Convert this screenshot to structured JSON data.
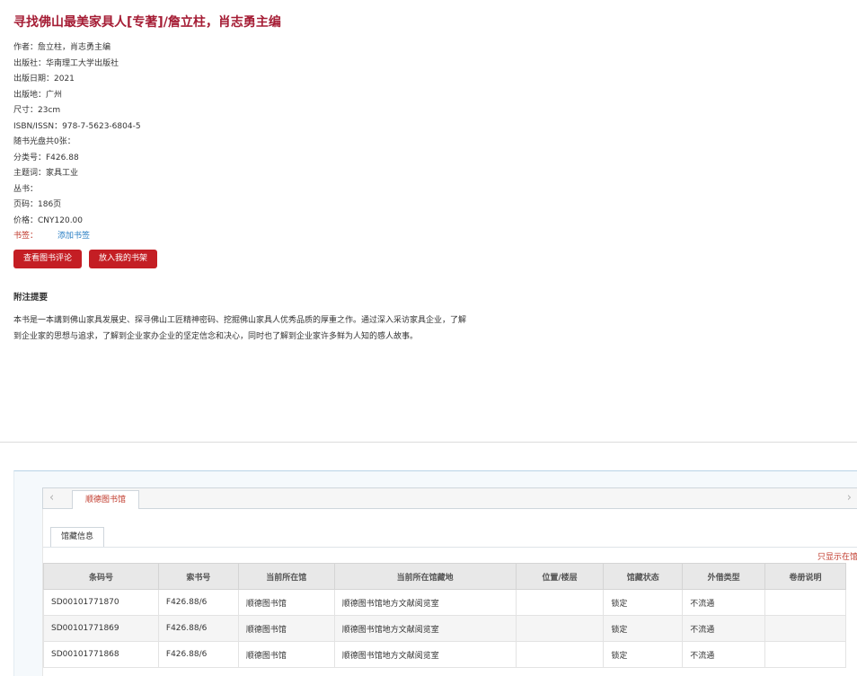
{
  "book": {
    "title": "寻找佛山最美家具人[专著]/詹立柱，肖志勇主编",
    "meta": [
      "作者：詹立柱，肖志勇主编",
      "出版社：华南理工大学出版社",
      "出版日期：2021",
      "出版地：广州",
      "尺寸：23cm",
      "ISBN/ISSN：978-7-5623-6804-5",
      "随书光盘共0张：",
      "分类号：F426.88",
      "主题词：家具工业",
      "丛书：",
      "页码：186页",
      "价格：CNY120.00"
    ],
    "bookmark_label": "书签：",
    "bookmark_link": "添加书签"
  },
  "actions": {
    "review_button": "查看图书评论",
    "shelf_button": "放入我的书架"
  },
  "notes": {
    "title": "附注提要",
    "body": "本书是一本講到佛山家具发展史、探寻佛山工匠精神密码、挖掘佛山家具人优秀品质的厚重之作。通过深入采访家具企业，了解到企业家的思想与追求，了解到企业家办企业的坚定信念和决心，同时也了解到企业家许多鲜为人知的感人故事。"
  },
  "holdings": {
    "library_tab": "顺德图书馆",
    "arrow_left": "‹",
    "arrow_right": "›",
    "subtab": "馆藏信息",
    "only_link": "只显示在馆",
    "columns": [
      "条码号",
      "索书号",
      "当前所在馆",
      "当前所在馆藏地",
      "位置/楼层",
      "馆藏状态",
      "外借类型",
      "卷册说明"
    ],
    "rows": [
      [
        "SD00101771870",
        "F426.88/6",
        "顺德图书馆",
        "顺德图书馆地方文献阅览室",
        "",
        "锁定",
        "不流通",
        ""
      ],
      [
        "SD00101771869",
        "F426.88/6",
        "顺德图书馆",
        "顺德图书馆地方文献阅览室",
        "",
        "锁定",
        "不流通",
        ""
      ],
      [
        "SD00101771868",
        "F426.88/6",
        "顺德图书馆",
        "顺德图书馆地方文献阅览室",
        "",
        "锁定",
        "不流通",
        ""
      ]
    ]
  },
  "colors": {
    "accent": "#a51d35",
    "button": "#c41e24",
    "link": "#2a7fc4"
  }
}
